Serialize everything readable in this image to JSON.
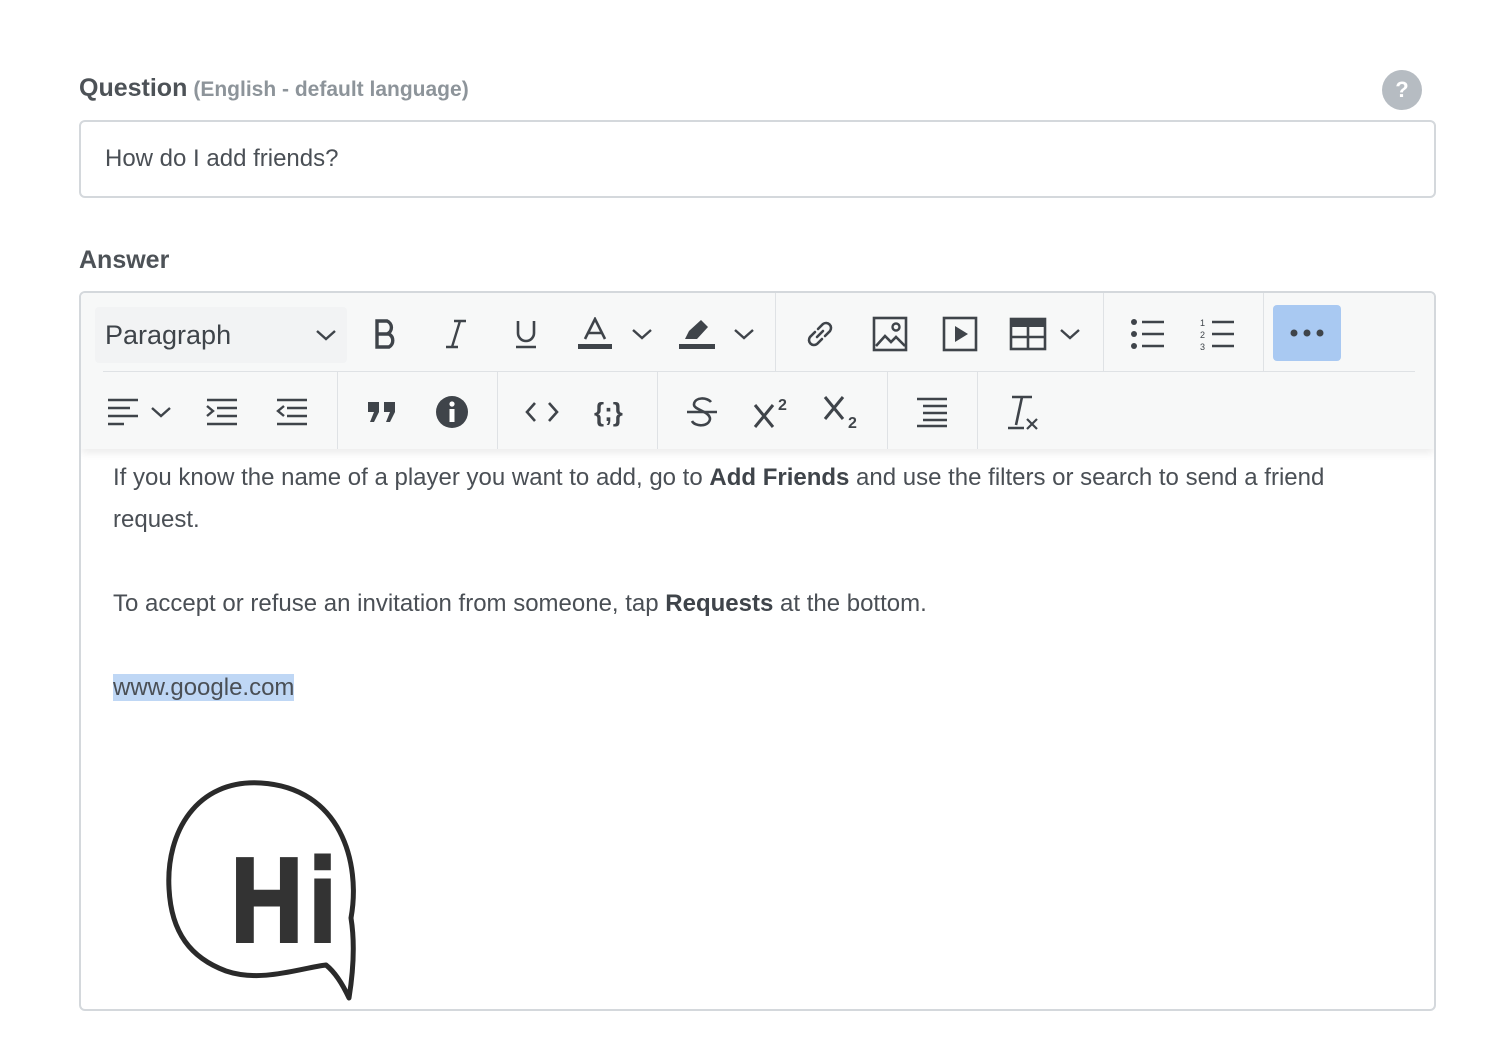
{
  "question": {
    "label": "Question",
    "sublabel": "(English - default language)",
    "help_icon": "?",
    "value": "How do I add friends?"
  },
  "answer": {
    "label": "Answer",
    "toolbar": {
      "block_format": "Paragraph",
      "row1_icons": [
        "bold-icon",
        "italic-icon",
        "underline-icon",
        "font-color-icon",
        "highlight-icon",
        "link-icon",
        "image-icon",
        "video-icon",
        "table-icon",
        "bullet-list-icon",
        "numbered-list-icon",
        "more-icon"
      ],
      "row2_icons": [
        "align-icon",
        "indent-icon",
        "outdent-icon",
        "blockquote-icon",
        "info-icon",
        "code-icon",
        "code-block-icon",
        "strikethrough-icon",
        "superscript-icon",
        "subscript-icon",
        "line-spacing-icon",
        "clear-format-icon"
      ]
    },
    "content": {
      "p1_before": "If you know the name of a player you want to add, go to ",
      "p1_bold": "Add Friends",
      "p1_after": " and use the filters or search to send a friend request.",
      "p2_before": "To accept or refuse an invitation from someone, tap ",
      "p2_bold": "Requests",
      "p2_after": " at the bottom.",
      "link_text": "www.google.com",
      "image_text": "Hi"
    }
  },
  "colors": {
    "accent": "#a9c9f2",
    "highlight": "#bfd7f5",
    "border": "#d4d8dc"
  }
}
